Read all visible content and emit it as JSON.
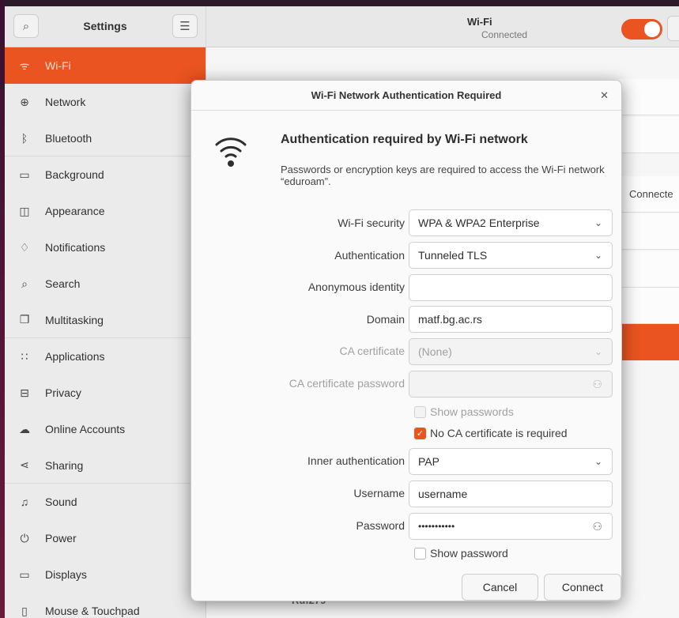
{
  "sidebar": {
    "title": "Settings",
    "items": [
      {
        "label": "Wi-Fi",
        "icon": "wifi-icon",
        "glyph": "ᯤ"
      },
      {
        "label": "Network",
        "icon": "network-icon",
        "glyph": "⊕"
      },
      {
        "label": "Bluetooth",
        "icon": "bluetooth-icon",
        "glyph": "ᛒ"
      },
      {
        "label": "Background",
        "icon": "background-icon",
        "glyph": "▭"
      },
      {
        "label": "Appearance",
        "icon": "appearance-icon",
        "glyph": "◫"
      },
      {
        "label": "Notifications",
        "icon": "bell-icon",
        "glyph": "♫"
      },
      {
        "label": "Search",
        "icon": "search-icon",
        "glyph": "⌕"
      },
      {
        "label": "Multitasking",
        "icon": "multitasking-icon",
        "glyph": "❐"
      },
      {
        "label": "Applications",
        "icon": "applications-icon",
        "glyph": "∷"
      },
      {
        "label": "Privacy",
        "icon": "lock-icon",
        "glyph": "⊟"
      },
      {
        "label": "Online Accounts",
        "icon": "cloud-icon",
        "glyph": "☁"
      },
      {
        "label": "Sharing",
        "icon": "share-icon",
        "glyph": "⋖"
      },
      {
        "label": "Sound",
        "icon": "music-icon",
        "glyph": "♫"
      },
      {
        "label": "Power",
        "icon": "power-icon",
        "glyph": "⏻"
      },
      {
        "label": "Displays",
        "icon": "display-icon",
        "glyph": "▭"
      },
      {
        "label": "Mouse & Touchpad",
        "icon": "mouse-icon",
        "glyph": "▯"
      }
    ]
  },
  "header": {
    "title": "Wi-Fi",
    "subtitle": "Connected"
  },
  "background": {
    "connected_label": "Connecte",
    "network_peek": "Ruf279"
  },
  "dialog": {
    "title": "Wi-Fi Network Authentication Required",
    "heading": "Authentication required by Wi-Fi network",
    "description": "Passwords or encryption keys are required to access the Wi-Fi network “eduroam”.",
    "fields": {
      "wifi_security": {
        "label": "Wi-Fi security",
        "value": "WPA & WPA2 Enterprise"
      },
      "authentication": {
        "label": "Authentication",
        "value": "Tunneled TLS"
      },
      "anonymous_identity": {
        "label": "Anonymous identity",
        "value": ""
      },
      "domain": {
        "label": "Domain",
        "value": "matf.bg.ac.rs"
      },
      "ca_certificate": {
        "label": "CA certificate",
        "value": "(None)"
      },
      "ca_certificate_password": {
        "label": "CA certificate password",
        "value": ""
      },
      "show_passwords": {
        "label": "Show passwords",
        "checked": false
      },
      "no_ca_required": {
        "label": "No CA certificate is required",
        "checked": true
      },
      "inner_authentication": {
        "label": "Inner authentication",
        "value": "PAP"
      },
      "username": {
        "label": "Username",
        "value": "username"
      },
      "password": {
        "label": "Password",
        "value": "•••••••••••"
      },
      "show_password": {
        "label": "Show password",
        "checked": false
      }
    },
    "buttons": {
      "cancel": "Cancel",
      "connect": "Connect"
    }
  },
  "colors": {
    "accent": "#e95420"
  }
}
